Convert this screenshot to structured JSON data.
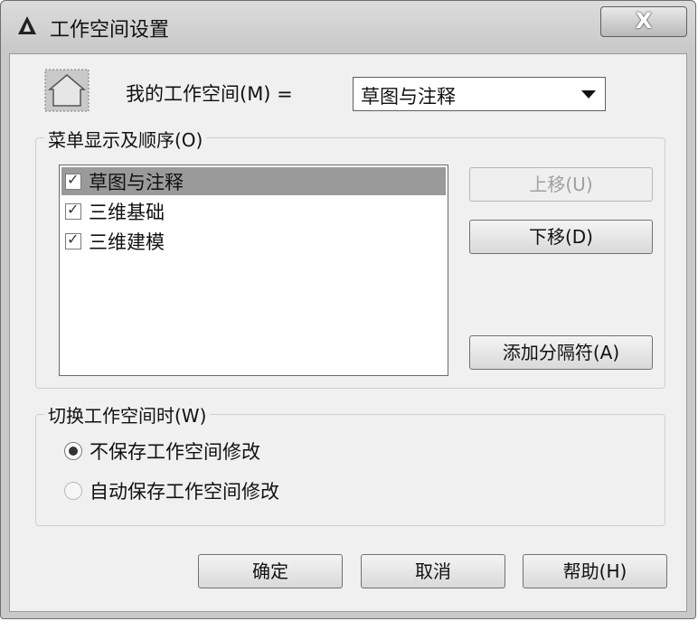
{
  "window": {
    "title": "工作空间设置",
    "close_label": "X"
  },
  "workspace": {
    "label": "我的工作空间(M) =",
    "selected": "草图与注释"
  },
  "menu_group": {
    "title": "菜单显示及顺序(O)",
    "items": [
      {
        "label": "草图与注释",
        "checked": true,
        "selected": true
      },
      {
        "label": "三维基础",
        "checked": true,
        "selected": false
      },
      {
        "label": "三维建模",
        "checked": true,
        "selected": false
      }
    ],
    "move_up_label": "上移(U)",
    "move_down_label": "下移(D)",
    "add_separator_label": "添加分隔符(A)"
  },
  "switch_group": {
    "title": "切换工作空间时(W)",
    "options": [
      {
        "label": "不保存工作空间修改",
        "checked": true
      },
      {
        "label": "自动保存工作空间修改",
        "checked": false
      }
    ]
  },
  "footer": {
    "ok_label": "确定",
    "cancel_label": "取消",
    "help_label": "帮助(H)"
  },
  "icons": {
    "app": "autocad-a-icon",
    "workspace": "house-icon",
    "check": "checkmark-icon"
  }
}
